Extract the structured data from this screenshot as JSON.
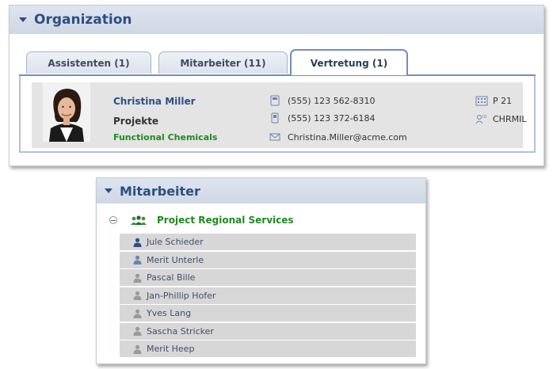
{
  "organization": {
    "title": "Organization",
    "tabs": [
      {
        "label": "Assistenten (1)",
        "active": false
      },
      {
        "label": "Mitarbeiter (11)",
        "active": false
      },
      {
        "label": "Vertretung (1)",
        "active": true
      }
    ],
    "person": {
      "name": "Christina Miller",
      "department": "Projekte",
      "company": "Functional Chemicals",
      "phone": "(555) 123 562-8310",
      "mobile": "(555) 123 372-6184",
      "email": "Christina.Miller@acme.com",
      "room": "P 21",
      "user_id": "CHRMIL"
    }
  },
  "mitarbeiter": {
    "title": "Mitarbeiter",
    "group": "Project Regional Services",
    "members": [
      {
        "name": "Jule Schieder",
        "status": "lead"
      },
      {
        "name": "Merit Unterle",
        "status": "active"
      },
      {
        "name": "Pascal Bille",
        "status": "inactive"
      },
      {
        "name": "Jan-Phillip Hofer",
        "status": "inactive"
      },
      {
        "name": "Yves Lang",
        "status": "inactive"
      },
      {
        "name": "Sascha Stricker",
        "status": "inactive"
      },
      {
        "name": "Merit Heep",
        "status": "inactive"
      }
    ]
  },
  "colors": {
    "header_text": "#2b4f86",
    "group_green": "#1f8a1f",
    "member_lead": "#2b4f86",
    "member_active": "#6d84ad",
    "member_inactive": "#9a9a9a"
  }
}
